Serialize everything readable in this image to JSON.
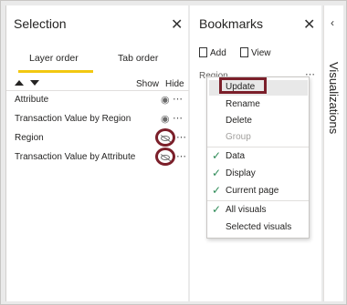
{
  "selection": {
    "title": "Selection",
    "tabs": [
      {
        "label": "Layer order",
        "active": true
      },
      {
        "label": "Tab order",
        "active": false
      }
    ],
    "show_label": "Show",
    "hide_label": "Hide",
    "layers": [
      {
        "name": "Attribute",
        "visible": true
      },
      {
        "name": "Transaction Value by Region",
        "visible": true
      },
      {
        "name": "Region",
        "visible": false
      },
      {
        "name": "Transaction Value by Attribute",
        "visible": false
      }
    ],
    "more_glyph": "⋯",
    "close_glyph": "✕"
  },
  "bookmarks": {
    "title": "Bookmarks",
    "add_label": "Add",
    "view_label": "View",
    "bookmark_name": "Region",
    "more_glyph": "⋯",
    "close_glyph": "✕"
  },
  "context_menu": {
    "items": {
      "update": "Update",
      "rename": "Rename",
      "delete": "Delete",
      "group": "Group",
      "data": "Data",
      "display": "Display",
      "current_page": "Current page",
      "all_visuals": "All visuals",
      "selected_visuals": "Selected visuals"
    },
    "check_glyph": "✓"
  },
  "visualizations": {
    "label": "Visualizations",
    "chevron_glyph": "‹"
  },
  "colors": {
    "tab_underline": "#f2c811",
    "highlight_ring": "#7b1f2a",
    "check": "#2e8b57"
  }
}
